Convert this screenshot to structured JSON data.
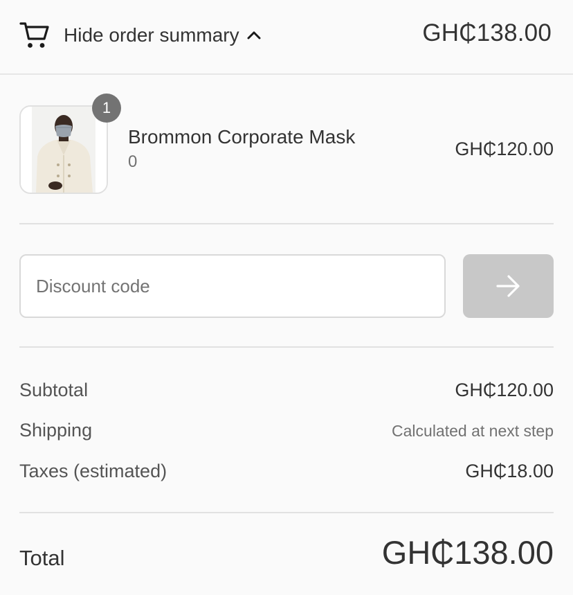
{
  "header": {
    "toggle_label": "Hide order summary",
    "total": "GH₵138.00"
  },
  "product": {
    "quantity": "1",
    "name": "Brommon Corporate Mask",
    "variant": "0",
    "price": "GH₵120.00"
  },
  "discount": {
    "placeholder": "Discount code",
    "value": ""
  },
  "summary": {
    "subtotal_label": "Subtotal",
    "subtotal_value": "GH₵120.00",
    "shipping_label": "Shipping",
    "shipping_value": "Calculated at next step",
    "taxes_label": "Taxes (estimated)",
    "taxes_value": "GH₵18.00",
    "total_label": "Total",
    "total_value": "GH₵138.00"
  },
  "icons": {
    "cart": "cart-icon",
    "chevron": "chevron-up-icon",
    "arrow": "arrow-right-icon"
  },
  "colors": {
    "background": "#fafafa",
    "text": "#333333",
    "muted_text": "#717171",
    "divider": "#e1e1e1",
    "badge": "#737373",
    "apply_button_disabled": "#c8c8c8"
  }
}
